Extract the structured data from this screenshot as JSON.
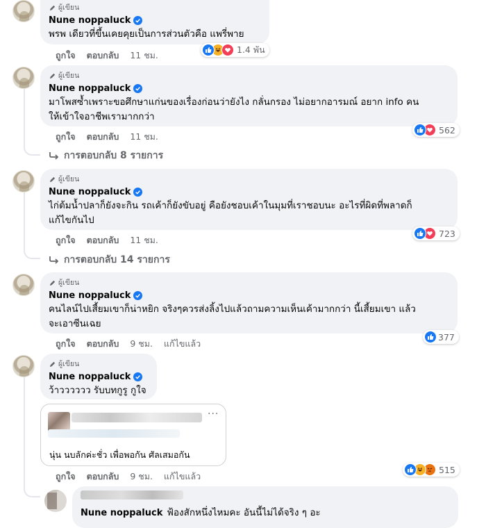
{
  "author_badge": "ผู้เขียน",
  "page_name": "Nune noppaluck",
  "action_like": "ถูกใจ",
  "action_reply": "ตอบกลับ",
  "edited_label": "แก้ไขแล้ว",
  "comments": [
    {
      "text": "พรพ เดียวที่ขึ้นเคยคุยเป็นการส่วนตัวคือ แพรี่พาย",
      "time": "11 ชม.",
      "reaction_icons": [
        "like-icon",
        "haha-icon",
        "love-icon"
      ],
      "reaction_count": "1.4 พัน"
    },
    {
      "text_line1": "มาโพสซ้ำเพราะขอศึกษาแก่นของเรื่องก่อนว่ายังไง กลั่นกรอง ไม่อยากอารมณ์ อยาก info คน",
      "text_line2": "ให้เข้าใจอาชีพเรามากกว่า",
      "time": "11 ชม.",
      "reaction_icons": [
        "like-icon",
        "love-icon"
      ],
      "reaction_count": "562",
      "replies_label": "การตอบกลับ 8 รายการ"
    },
    {
      "text_line1": "ไก่ต้มน้ำปลาก็ยังจะกิน รถเค้าก็ยังขับอยู่ คือยังชอบเค้าในมุมที่เราชอบนะ อะไรที่ผิดที่พลาดก็",
      "text_line2": "แก้ไขกันไป",
      "time": "11 ชม.",
      "reaction_icons": [
        "like-icon",
        "love-icon"
      ],
      "reaction_count": "723",
      "replies_label": "การตอบกลับ 14 รายการ"
    },
    {
      "text_line1": "คนไลน์ไปเสี้ยมเขาก็น่าหยิก จริงๆควรส่งลิ้งไปแล้วถามความเห็นเค้ามากกว่า นี้เสี้ยมเขา แล้ว",
      "text_line2": "จะเอาซีนเฉย",
      "time": "9 ชม.",
      "reaction_icons": [
        "like-icon"
      ],
      "reaction_count": "377"
    },
    {
      "text": "ว้าวววววว รับบทกูรู กูใจ",
      "time": "9 ชม.",
      "quoted_text": "นุ่น นบลักค่ะชั่ว เพื่อพอกัน ศัลเสมอกัน",
      "quoted_more": "···",
      "reaction_icons": [
        "like-icon",
        "haha-icon",
        "angry-icon"
      ],
      "reaction_count": "515"
    }
  ],
  "last_reply_text": "ฟ้องสักหนึ่งไหมคะ อันนี้ไม่ได้จริง ๆ อะ",
  "colors": {
    "bubble": "#f0f2f5",
    "secondary_text": "#65676b",
    "like_blue": "#1877f2",
    "love_red": "#f33e58",
    "haha_yellow": "#f7b125",
    "angry_orange": "#e9710f"
  }
}
